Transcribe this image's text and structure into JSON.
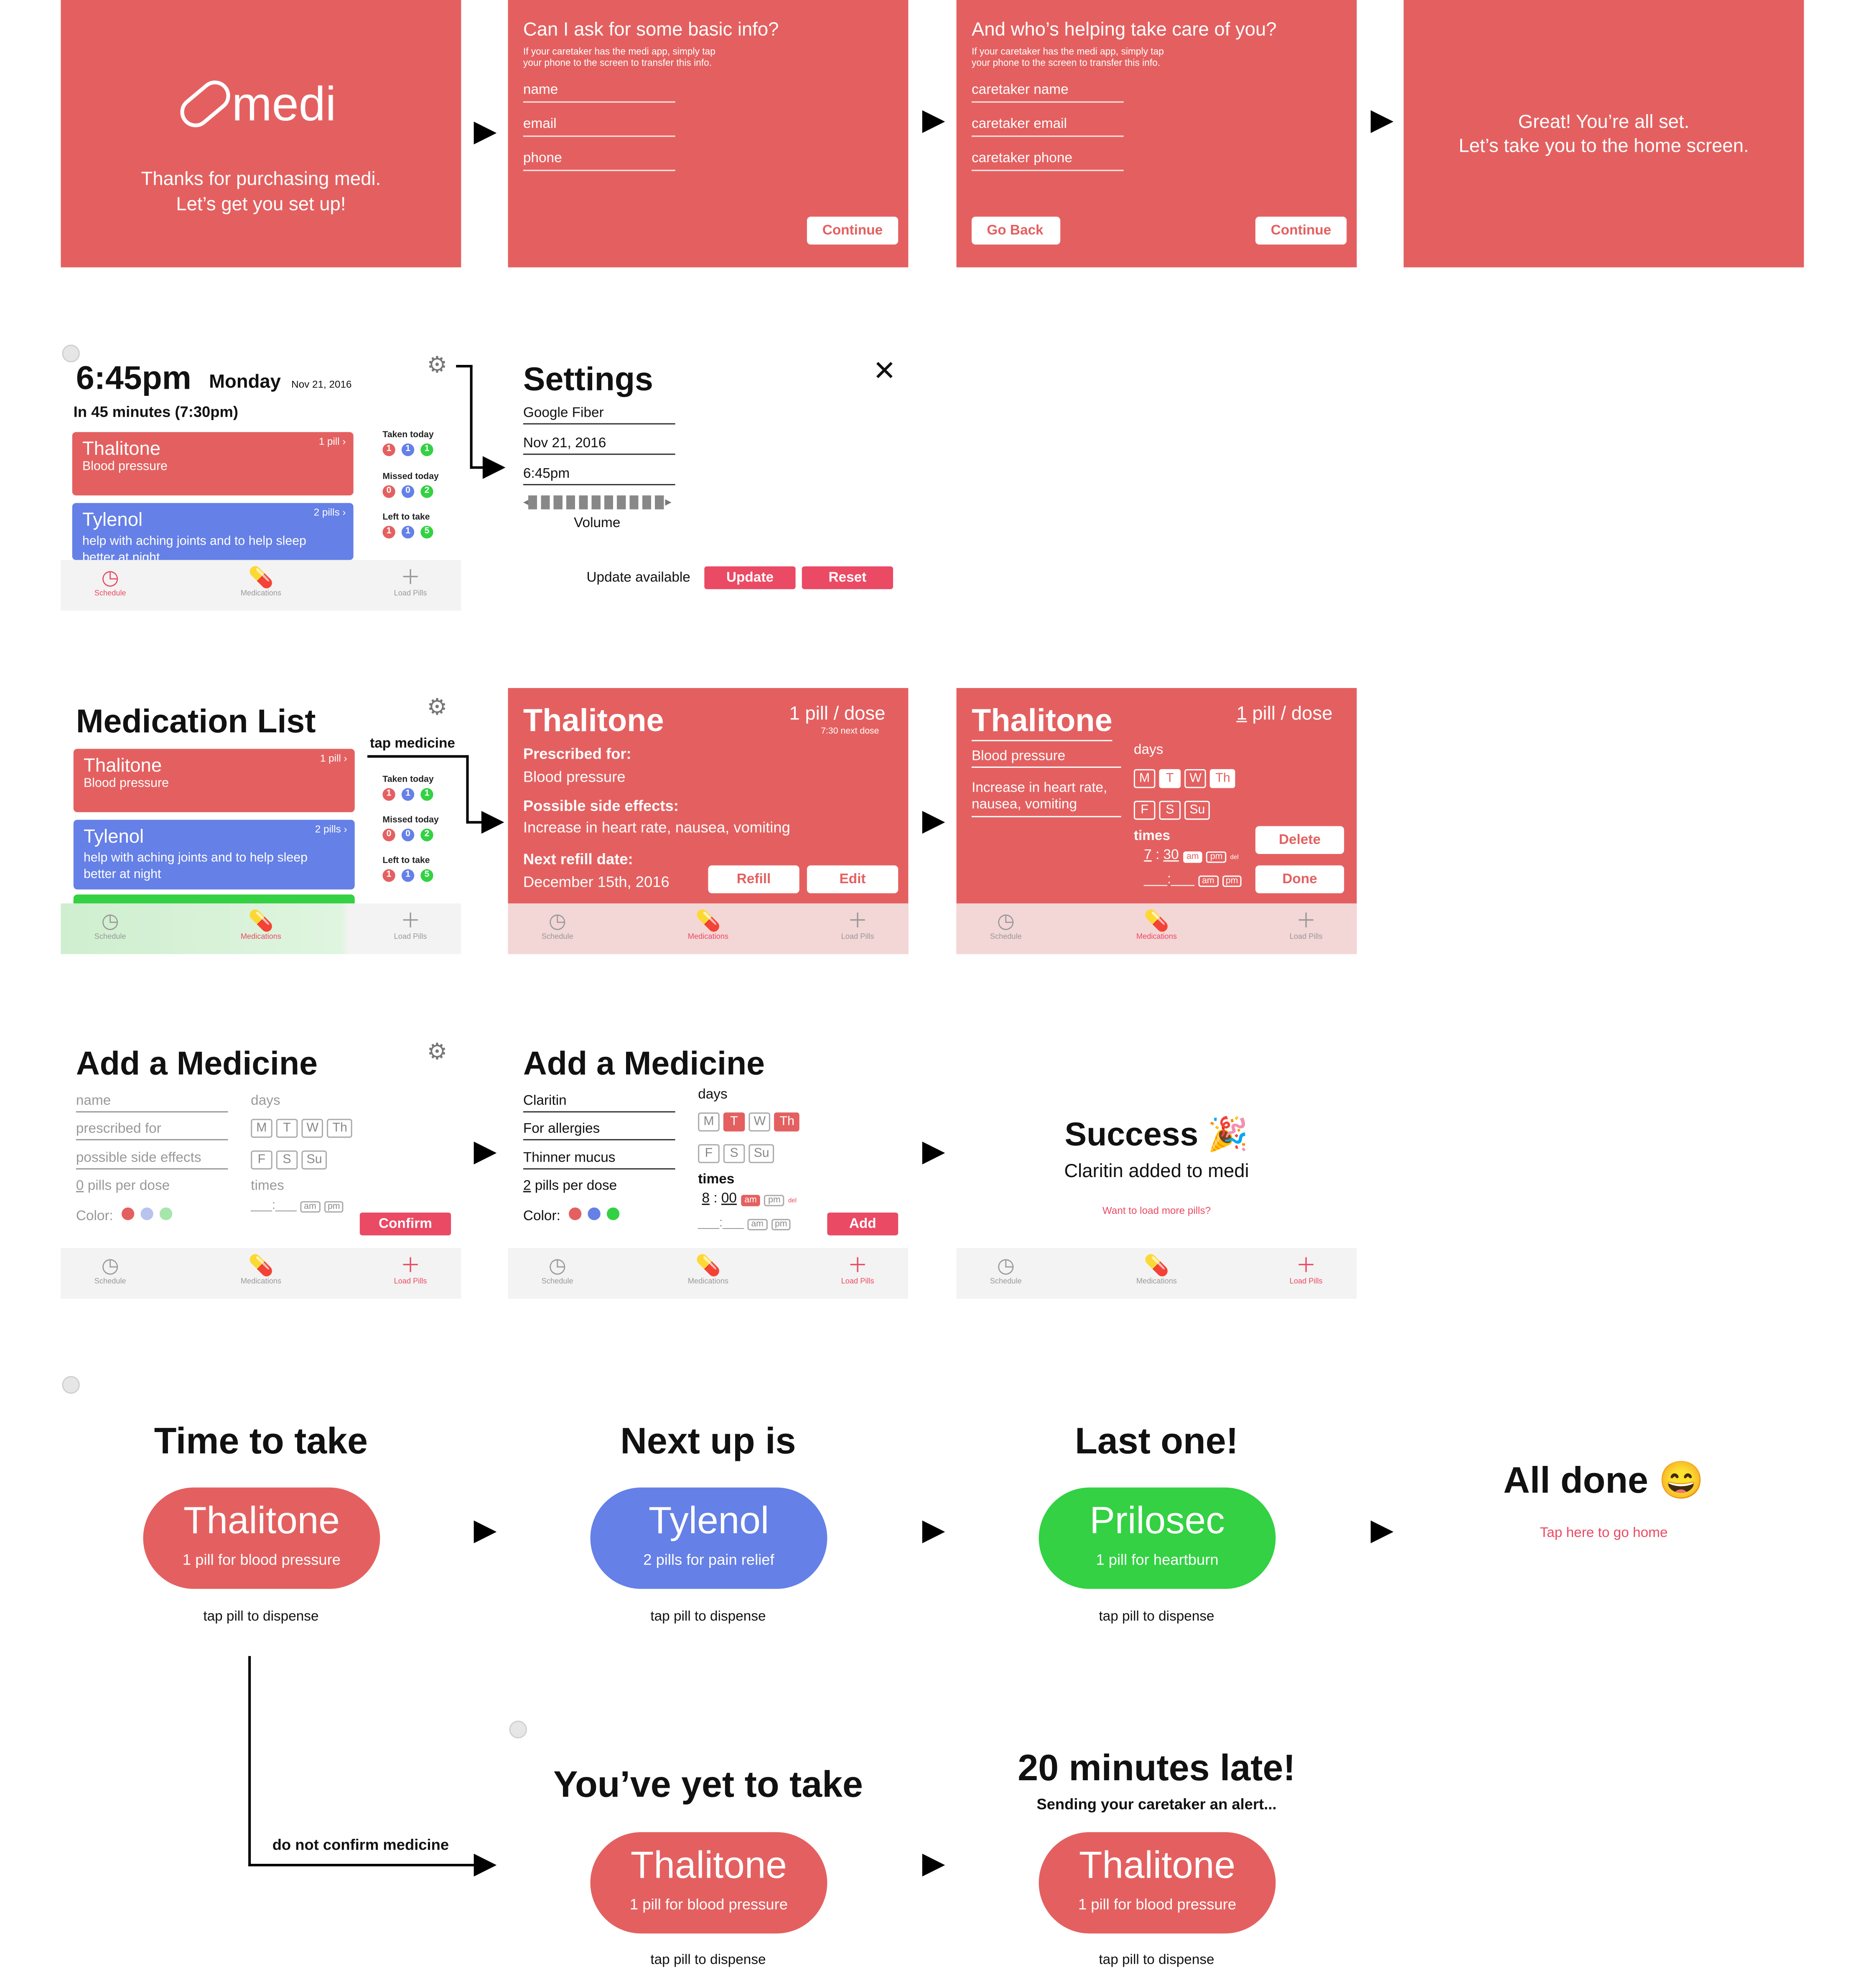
{
  "onboarding": {
    "logo": "medi",
    "thanks": "Thanks for purchasing medi.",
    "setup": "Let’s get you set up!",
    "info_title": "Can I ask for some basic info?",
    "info_sub1": "If your caretaker has the medi app, simply tap",
    "info_sub2": "your phone to the screen to transfer this info.",
    "fields": [
      "name",
      "email",
      "phone"
    ],
    "continue": "Continue",
    "care_title": "And who’s helping take care of you?",
    "care_fields": [
      "caretaker name",
      "caretaker email",
      "caretaker phone"
    ],
    "go_back": "Go Back",
    "done1": "Great! You’re all set.",
    "done2": "Let’s take you to the home screen."
  },
  "home": {
    "time": "6:45pm",
    "day": "Monday",
    "date": "Nov 21, 2016",
    "next": "In 45 minutes (7:30pm)",
    "taken": "Taken today",
    "missed": "Missed today",
    "left": "Left to take",
    "taken_vals": [
      "1",
      "1",
      "1"
    ],
    "missed_vals": [
      "0",
      "0",
      "2"
    ],
    "left_vals": [
      "1",
      "1",
      "5"
    ]
  },
  "meds": [
    {
      "name": "Thalitone",
      "desc": "Blood pressure",
      "dose": "1 pill"
    },
    {
      "name": "Tylenol",
      "desc": "help with aching joints and to help sleep better at night",
      "dose": "2 pills"
    }
  ],
  "tabs": {
    "schedule": "Schedule",
    "medications": "Medications",
    "load": "Load Pills"
  },
  "settings": {
    "title": "Settings",
    "wifi": "Google Fiber",
    "date": "Nov 21, 2016",
    "time": "6:45pm",
    "volume": "Volume",
    "update_text": "Update available",
    "update": "Update",
    "reset": "Reset"
  },
  "medlist": {
    "title": "Medication List",
    "tap": "tap medicine"
  },
  "detail": {
    "name": "Thalitone",
    "dose": "1 pill / dose",
    "next_dose": "7:30 next dose",
    "pres_label": "Prescribed for:",
    "pres": "Blood pressure",
    "side_label": "Possible side effects:",
    "side": "Increase in heart rate, nausea, vomiting",
    "refill_label": "Next refill date:",
    "refill_date": "December 15th, 2016",
    "refill": "Refill",
    "edit": "Edit"
  },
  "edit": {
    "name": "Thalitone",
    "dose_num": "1",
    "dose_rest": " pill / dose",
    "pres": "Blood pressure",
    "side1": "Increase in heart rate,",
    "side2": "nausea, vomiting",
    "days": "days",
    "times": "times",
    "t1h": "7",
    "t1m": "30",
    "am": "am",
    "pm": "pm",
    "del": "del",
    "delete": "Delete",
    "done": "Done"
  },
  "days": [
    "M",
    "T",
    "W",
    "Th",
    "F",
    "S",
    "Su"
  ],
  "add": {
    "title": "Add a Medicine",
    "name": "name",
    "for": "prescribed for",
    "side": "possible side effects",
    "dose_num": "0",
    "dose": " pills per dose",
    "color": "Color:",
    "days": "days",
    "times": "times",
    "confirm": "Confirm",
    "f_name": "Claritin",
    "f_for": "For allergies",
    "f_side": "Thinner mucus",
    "f_dose_num": "2",
    "f_h": "8",
    "f_m": "00",
    "add": "Add"
  },
  "success": {
    "title": "Success",
    "emoji": "🎉",
    "msg": "Claritin added to medi",
    "link": "Want to load more pills?"
  },
  "dispense": {
    "time_to_take": "Time to take",
    "next_up": "Next up is",
    "last": "Last one!",
    "all_done": "All done",
    "smile": "😄",
    "go_home": "Tap here to go home",
    "tap": "tap pill to dispense",
    "p1": {
      "name": "Thalitone",
      "desc": "1 pill for blood pressure"
    },
    "p2": {
      "name": "Tylenol",
      "desc": "2 pills for pain relief"
    },
    "p3": {
      "name": "Prilosec",
      "desc": "1 pill for heartburn"
    },
    "no_confirm": "do not confirm medicine",
    "yet": "You’ve yet to take",
    "late": "20 minutes late!",
    "alert": "Sending your caretaker an alert..."
  },
  "colors": {
    "red": "#e46060",
    "pink": "#ea4a64",
    "blue": "#6580e6",
    "green": "#33d143"
  }
}
